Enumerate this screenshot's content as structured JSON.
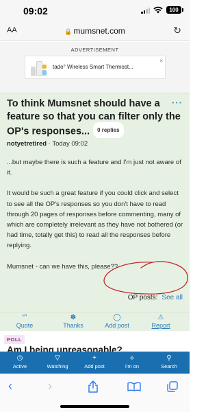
{
  "status": {
    "time": "09:02",
    "battery": "100"
  },
  "browser": {
    "text_size": "AA",
    "url": "mumsnet.com",
    "reload_icon": "reload-icon"
  },
  "ad": {
    "label": "ADVERTISEMENT",
    "text": "tado° Wireless Smart Thermost...",
    "close": "×"
  },
  "thread": {
    "title": "To think Mumsnet should have a feature so that you can filter only the OP's responses...",
    "replies": "0 replies",
    "menu": "···",
    "author": "notyetretired",
    "timestamp": "Today 09:02",
    "body": [
      "...but maybe there is such a feature and I'm just not aware of it.",
      "It would be such a great feature if you could click and select to see all the OP's responses so you don't have to read through 20 pages of responses before commenting, many of which are completely irrelevant as they have not bothered (or had time, totally get this) to read all the responses before replying.",
      "Mumsnet - can we have this, please??"
    ],
    "op_posts_label": "OP posts:",
    "see_all": "See all"
  },
  "actions": [
    {
      "label": "Quote",
      "icon": "quote-icon"
    },
    {
      "label": "Thanks",
      "icon": "thanks-icon"
    },
    {
      "label": "Add post",
      "icon": "speech-bubble-icon"
    },
    {
      "label": "Report",
      "icon": "report-icon"
    }
  ],
  "next_section": {
    "badge": "POLL",
    "title": "Am I being unreasonable?"
  },
  "site_nav": [
    {
      "label": "Active",
      "icon": "clock-icon"
    },
    {
      "label": "Watching",
      "icon": "filter-icon"
    },
    {
      "label": "Add post",
      "icon": "plus-icon"
    },
    {
      "label": "I'm on",
      "icon": "pin-icon"
    },
    {
      "label": "Search",
      "icon": "search-icon"
    }
  ],
  "colors": {
    "post_bg": "#e6f1e3",
    "accent": "#2b7bb8",
    "nav_bg": "#1a6fb0",
    "annotation": "#c0282d",
    "safari_blue": "#2e7cf6"
  }
}
